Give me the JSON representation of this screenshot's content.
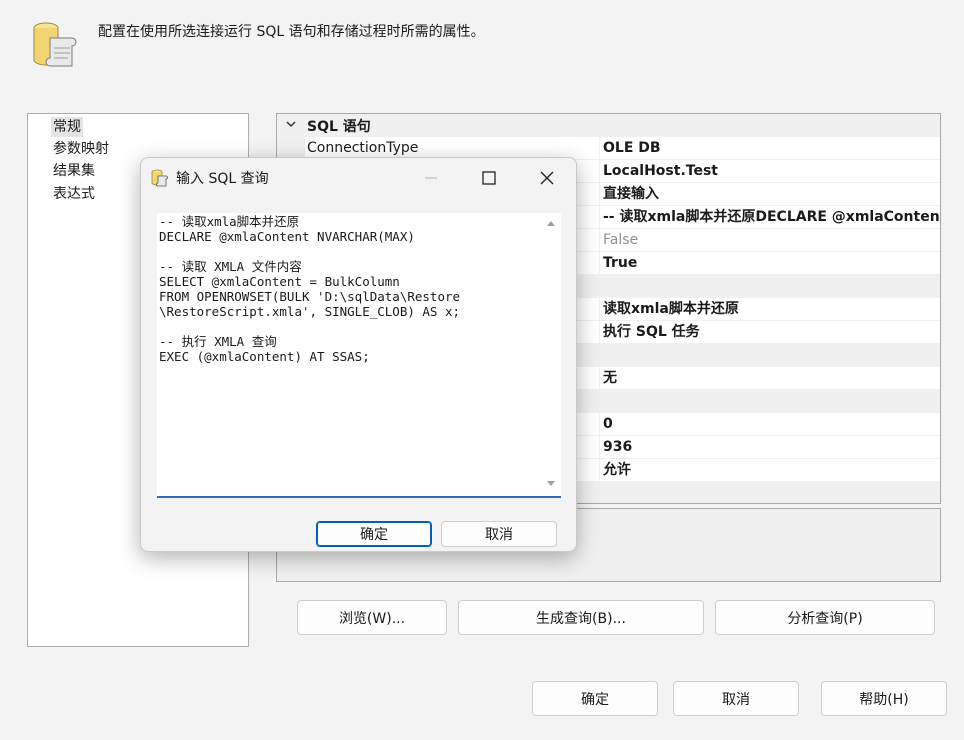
{
  "header": {
    "description": "配置在使用所选连接运行 SQL 语句和存储过程时所需的属性。"
  },
  "nav": {
    "items": [
      {
        "label": "常规",
        "selected": true
      },
      {
        "label": "参数映射",
        "selected": false
      },
      {
        "label": "结果集",
        "selected": false
      },
      {
        "label": "表达式",
        "selected": false
      }
    ]
  },
  "grid": {
    "category": "SQL 语句",
    "rows": [
      {
        "name": "ConnectionType",
        "value": "OLE DB"
      },
      {
        "name": "",
        "value": "LocalHost.Test"
      },
      {
        "name": "",
        "value": "直接输入"
      },
      {
        "name": "",
        "value": "-- 读取xmla脚本并还原DECLARE @xmlaConten"
      },
      {
        "name": "",
        "value": "False"
      },
      {
        "name": "",
        "value": "True"
      },
      {
        "name": "",
        "value": "读取xmla脚本并还原"
      },
      {
        "name": "",
        "value": "执行 SQL 任务"
      },
      {
        "name": "",
        "value": "无"
      },
      {
        "name": "",
        "value": "0"
      },
      {
        "name": "",
        "value": "936"
      },
      {
        "name": "",
        "value": "允许"
      }
    ]
  },
  "buttons": {
    "browse": "浏览(W)...",
    "build_query": "生成查询(B)...",
    "parse_query": "分析查询(P)",
    "ok": "确定",
    "cancel": "取消",
    "help": "帮助(H)"
  },
  "dialog": {
    "title": "输入 SQL 查询",
    "sql_text": "-- 读取xmla脚本并还原\nDECLARE @xmlaContent NVARCHAR(MAX)\n\n-- 读取 XMLA 文件内容\nSELECT @xmlaContent = BulkColumn\nFROM OPENROWSET(BULK 'D:\\sqlData\\Restore\n\\RestoreScript.xmla', SINGLE_CLOB) AS x;\n\n-- 执行 XMLA 查询\nEXEC (@xmlaContent) AT SSAS;",
    "ok": "确定",
    "cancel": "取消"
  },
  "colors": {
    "accent": "#005fb8",
    "window_bg": "#f3f3f3",
    "grid_bg": "#f0f0f0"
  },
  "icons": {
    "header": "database-scroll-icon",
    "dialog": "database-scroll-icon",
    "category": "chevron-down-icon",
    "minimize": "minimize-icon",
    "maximize": "maximize-icon",
    "close": "close-icon"
  }
}
